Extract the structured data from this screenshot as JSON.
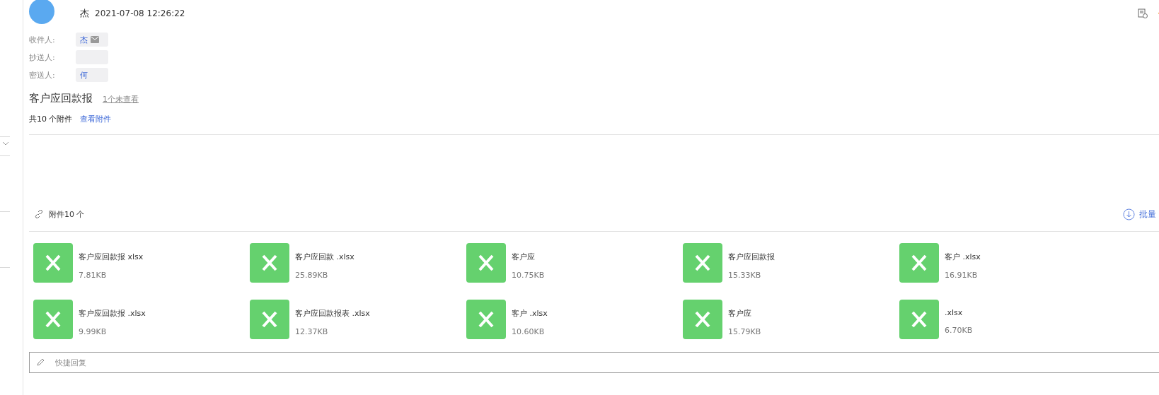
{
  "sender": {
    "name": "杰",
    "time": "2021-07-08 12:26:22"
  },
  "recipients": [
    {
      "label": "收件人:",
      "value": "杰",
      "envelope": true
    },
    {
      "label": "抄送人:",
      "envelope": false
    },
    {
      "label": "密送人:",
      "value": "何",
      "envelope": false
    }
  ],
  "subject": {
    "title": "客户应回款报",
    "unread_link": "1个未查看"
  },
  "attachment_summary": {
    "count": "共10 个附件",
    "link": "查看附件"
  },
  "attachments_header": {
    "title": "附件10 个",
    "batch": "批量"
  },
  "attachments": [
    {
      "name": "客户应回款报 xlsx",
      "size": "7.81KB"
    },
    {
      "name": "客户应回款 .xlsx",
      "size": "25.89KB"
    },
    {
      "name": "客户应",
      "size": "10.75KB"
    },
    {
      "name": "客户应回款报",
      "size": "15.33KB"
    },
    {
      "name": "客户 .xlsx",
      "size": "16.91KB"
    },
    {
      "name": "客户应回款报 .xlsx",
      "size": "9.99KB"
    },
    {
      "name": "客户应回款报表 .xlsx",
      "size": "12.37KB"
    },
    {
      "name": "客户 .xlsx",
      "size": "10.60KB"
    },
    {
      "name": "客户应",
      "size": "15.79KB"
    },
    {
      "name": ".xlsx",
      "size": "6.70KB"
    }
  ],
  "reply": {
    "placeholder": "快捷回复"
  }
}
